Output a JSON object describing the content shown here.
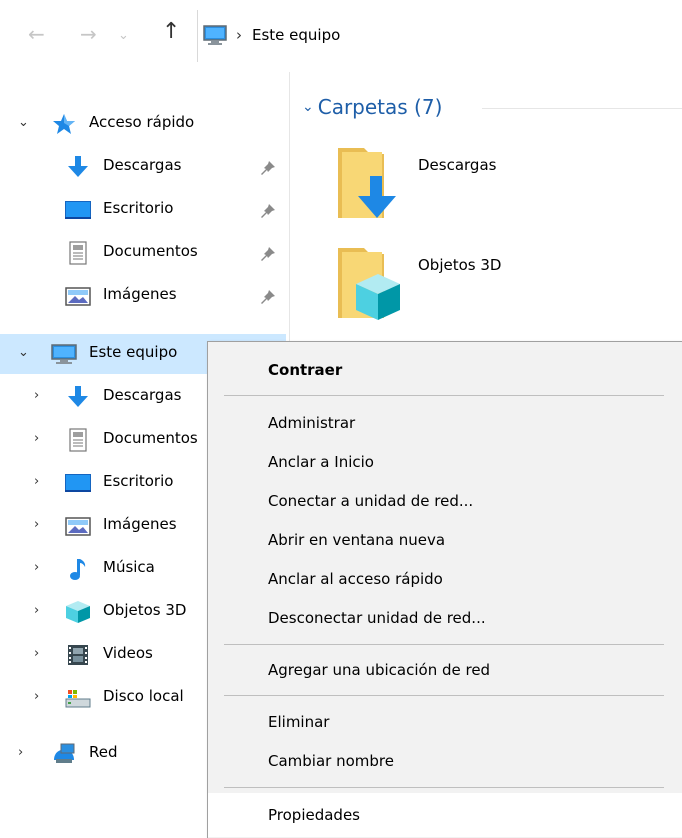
{
  "nav": {
    "back_icon": "arrow-left-icon",
    "forward_icon": "arrow-right-icon",
    "recent_icon": "chevron-down-icon",
    "up_icon": "arrow-up-icon",
    "address": {
      "location_icon": "this-pc-icon",
      "path": "Este equipo"
    }
  },
  "sidebar": {
    "quick_access": {
      "label": "Acceso rápido",
      "icon": "star-icon",
      "items": [
        {
          "label": "Descargas",
          "icon": "download-icon",
          "pinned": true
        },
        {
          "label": "Escritorio",
          "icon": "desktop-icon",
          "pinned": true
        },
        {
          "label": "Documentos",
          "icon": "document-icon",
          "pinned": true
        },
        {
          "label": "Imágenes",
          "icon": "pictures-icon",
          "pinned": true
        }
      ]
    },
    "this_pc": {
      "label": "Este equipo",
      "icon": "this-pc-icon",
      "items": [
        {
          "label": "Descargas",
          "icon": "download-icon"
        },
        {
          "label": "Documentos",
          "icon": "document-icon"
        },
        {
          "label": "Escritorio",
          "icon": "desktop-icon"
        },
        {
          "label": "Imágenes",
          "icon": "pictures-icon"
        },
        {
          "label": "Música",
          "icon": "music-note-icon"
        },
        {
          "label": "Objetos 3D",
          "icon": "cube-3d-icon"
        },
        {
          "label": "Videos",
          "icon": "film-icon"
        },
        {
          "label": "Disco local",
          "icon": "drive-icon"
        }
      ]
    },
    "network": {
      "label": "Red",
      "icon": "network-icon"
    }
  },
  "main": {
    "group_title": "Carpetas (7)",
    "folders": [
      {
        "label": "Descargas",
        "icon": "download-folder-icon"
      },
      {
        "label": "Objetos 3D",
        "icon": "cube-folder-icon"
      }
    ]
  },
  "context_menu": {
    "items": [
      {
        "label": "Contraer",
        "bold": true
      },
      {
        "label": "Administrar"
      },
      {
        "label": "Anclar a Inicio"
      },
      {
        "label": "Conectar a unidad de red..."
      },
      {
        "label": "Abrir en ventana nueva"
      },
      {
        "label": "Anclar al acceso rápido"
      },
      {
        "label": "Desconectar unidad de red..."
      },
      {
        "label": "Agregar una ubicación de red"
      },
      {
        "label": "Eliminar"
      },
      {
        "label": "Cambiar nombre"
      },
      {
        "label": "Propiedades",
        "highlighted": true
      }
    ]
  },
  "colors": {
    "selection": "#cce8ff",
    "group_title": "#1e5ea8",
    "menu_bg": "#f2f2f2",
    "menu_hover": "#ffffff",
    "folder_yellow": "#f8d775",
    "download_blue": "#1e88e5"
  }
}
